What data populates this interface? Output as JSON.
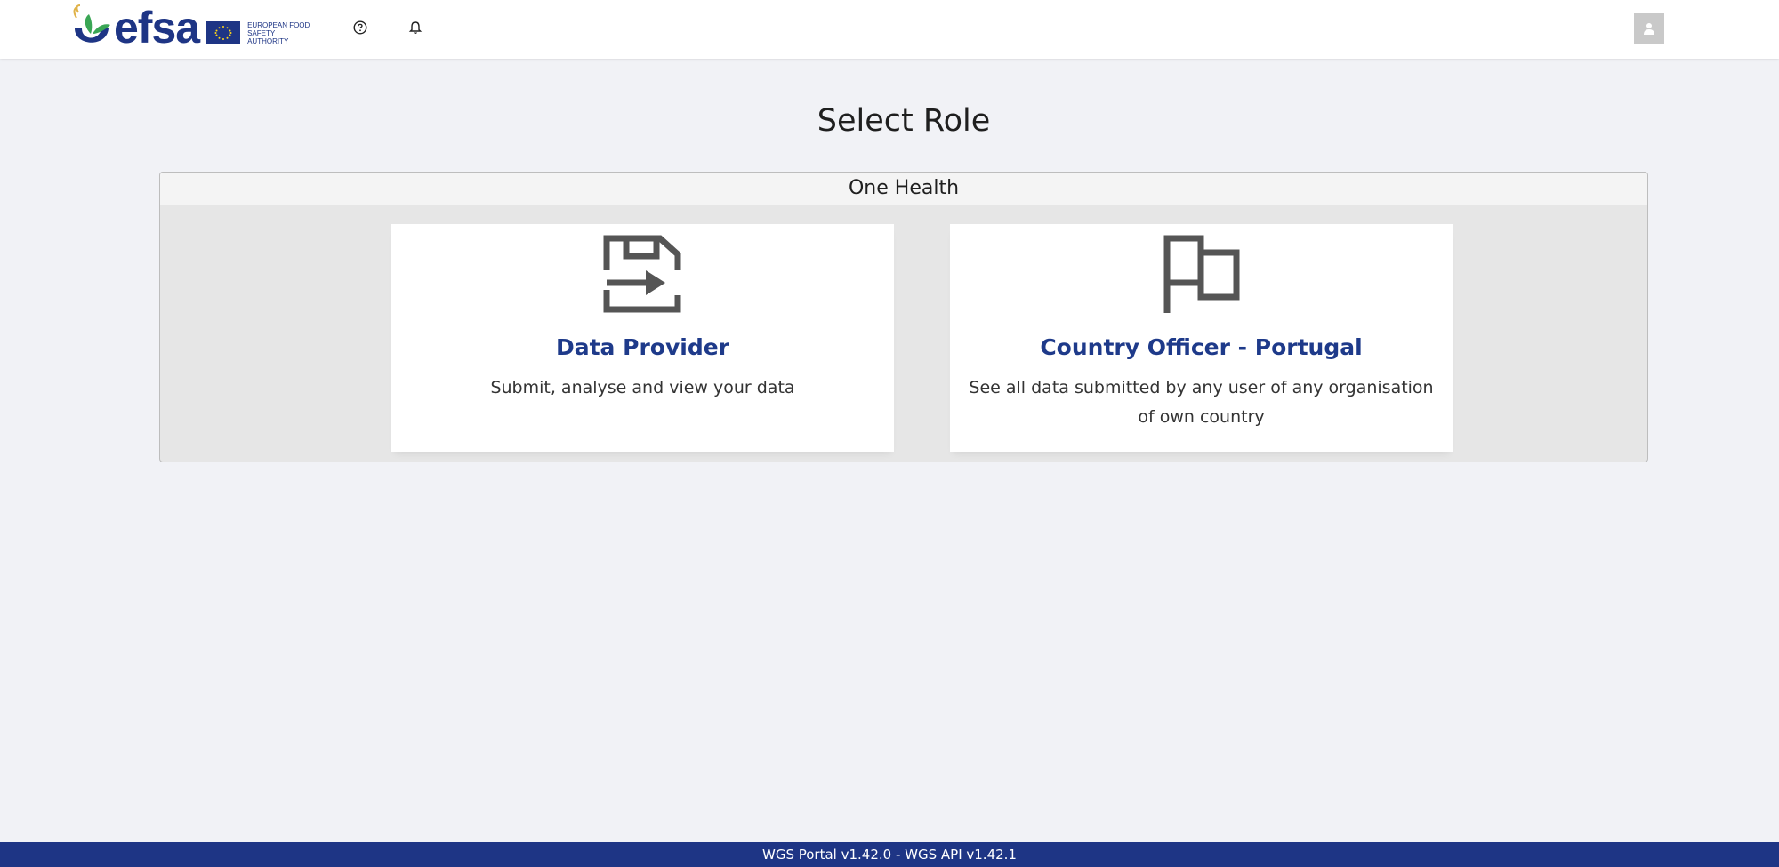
{
  "header": {
    "logo_text": "efsa",
    "authority_line1": "EUROPEAN FOOD",
    "authority_line2": "SAFETY AUTHORITY",
    "help_icon": "question-circle-icon",
    "notifications_icon": "bell-icon",
    "user_icon": "user-avatar-icon"
  },
  "page": {
    "title": "Select Role"
  },
  "panel": {
    "title": "One Health",
    "cards": [
      {
        "icon": "data-submit-icon",
        "title": "Data Provider",
        "description": "Submit, analyse and view your data"
      },
      {
        "icon": "flag-icon",
        "title": "Country Officer - Portugal",
        "description": "See all data submitted by any user of any organisation of own country"
      }
    ]
  },
  "footer": {
    "version_text": "WGS Portal v1.42.0 - WGS API v1.42.1"
  },
  "colors": {
    "brand_blue": "#1e3585",
    "card_title": "#1e3a8a",
    "icon_gray": "#555555",
    "background": "#f1f2f6"
  }
}
